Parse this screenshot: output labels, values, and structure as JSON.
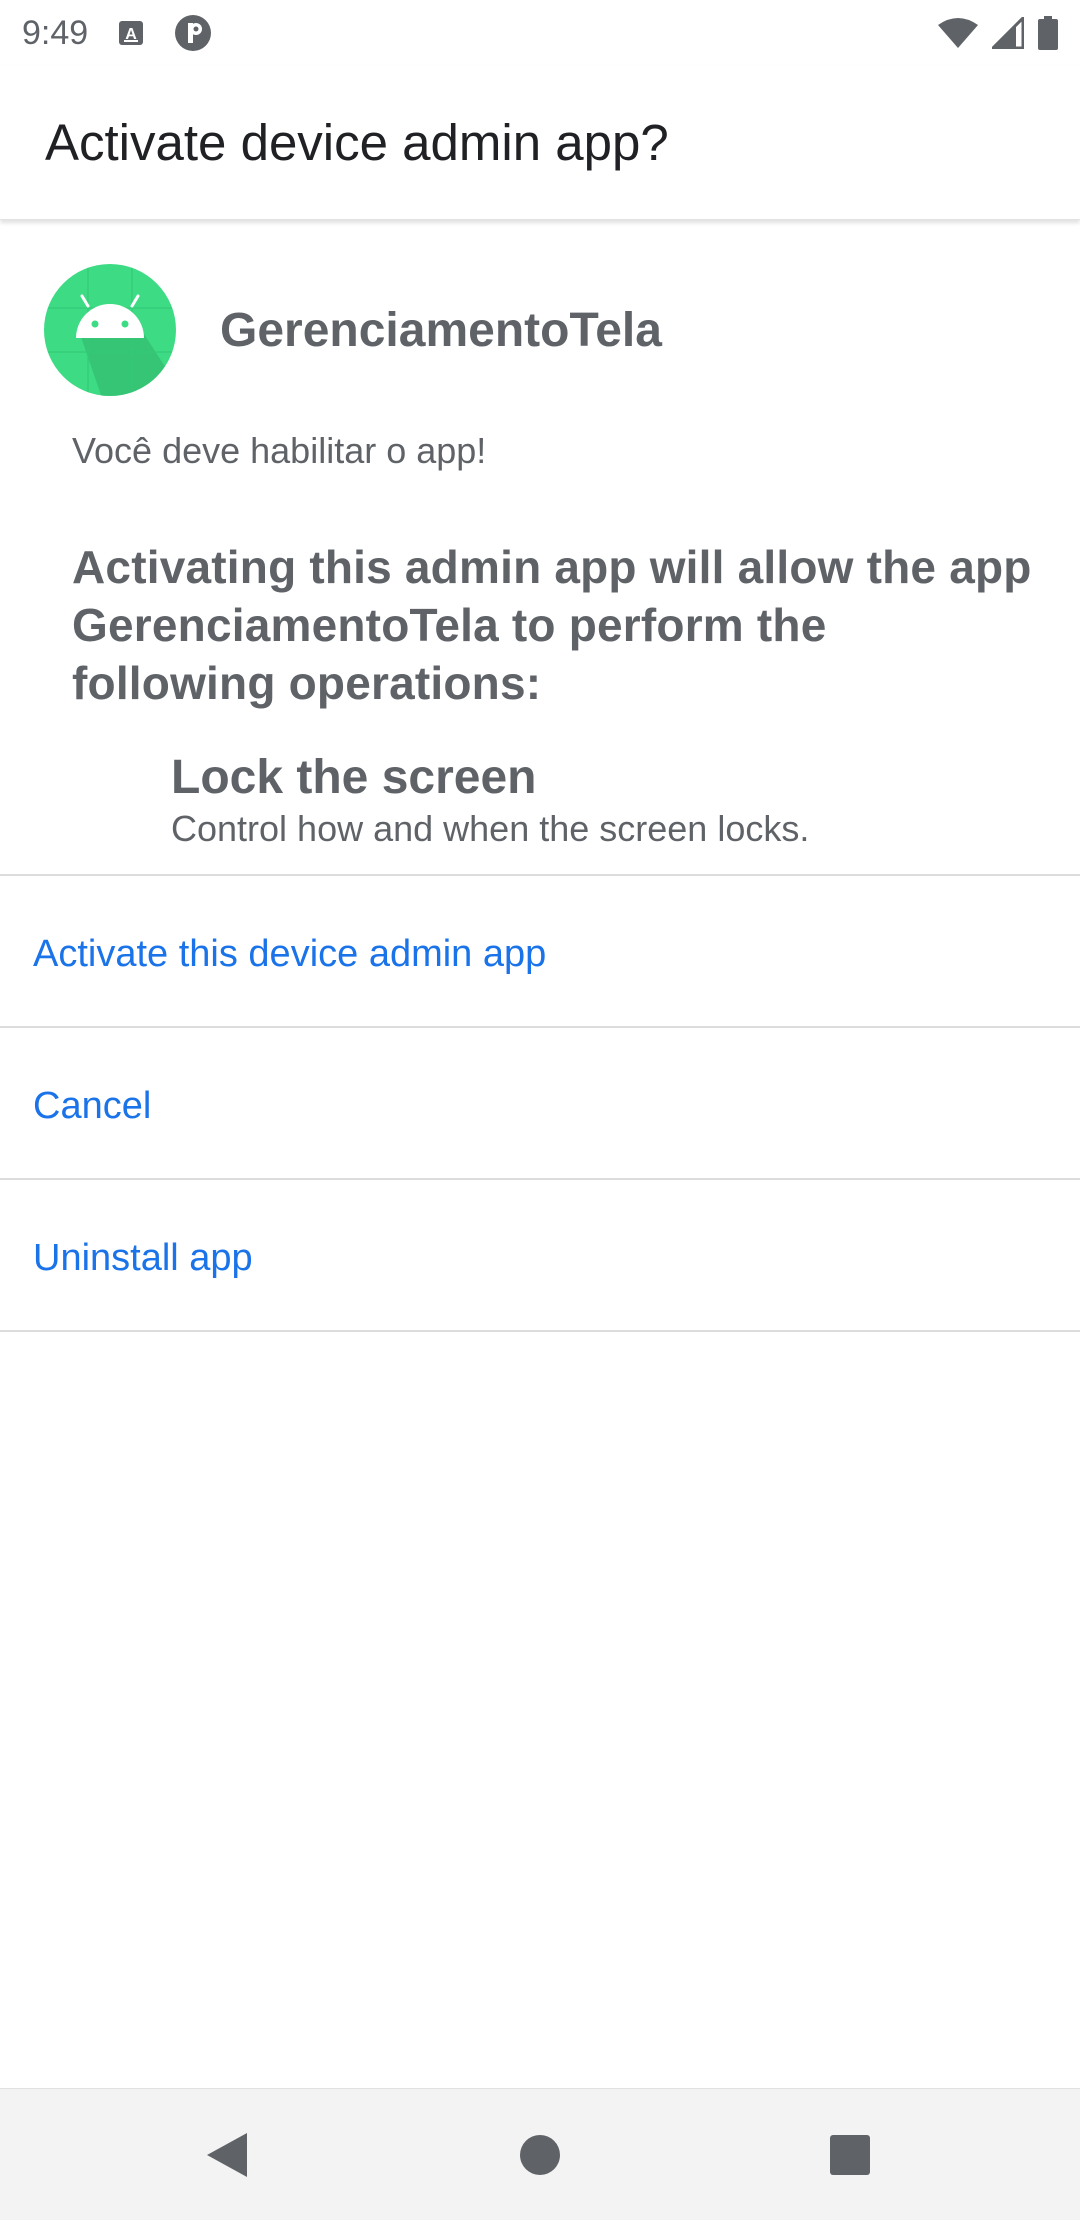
{
  "status_bar": {
    "time": "9:49",
    "icons": [
      "keyboard-notification-icon",
      "app-notification-icon",
      "wifi-icon",
      "cell-signal-icon",
      "battery-icon"
    ]
  },
  "header": {
    "title": "Activate device admin app?"
  },
  "app": {
    "name": "GerenciamentoTela",
    "icon": "android-app-icon",
    "subtitle": "Você deve habilitar o app!"
  },
  "description": "Activating this admin app will allow the app GerenciamentoTela to perform the following operations:",
  "policy": {
    "title": "Lock the screen",
    "description": "Control how and when the screen locks."
  },
  "actions": {
    "activate": "Activate this device admin app",
    "cancel": "Cancel",
    "uninstall": "Uninstall app"
  },
  "colors": {
    "accent": "#1a73e8",
    "text_secondary": "#5f6368",
    "android_green": "#3ddc84"
  },
  "nav": [
    "back-icon",
    "home-icon",
    "recents-icon"
  ]
}
